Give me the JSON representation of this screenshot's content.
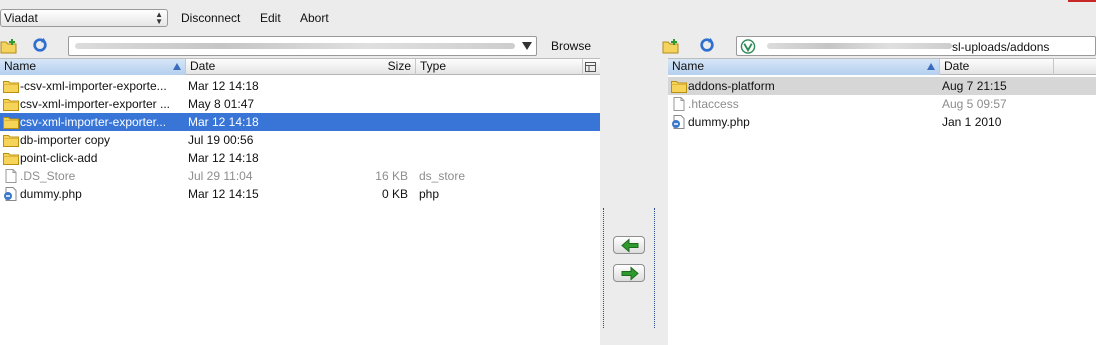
{
  "toolbar": {
    "server_select": "Viadat",
    "disconnect": "Disconnect",
    "edit": "Edit",
    "abort": "Abort"
  },
  "local": {
    "browse": "Browse",
    "columns": {
      "name": "Name",
      "date": "Date",
      "size": "Size",
      "type": "Type"
    },
    "rows": [
      {
        "name": "-csv-xml-importer-exporte...",
        "date": "Mar 12 14:18",
        "size": "",
        "type": "",
        "kind": "folder"
      },
      {
        "name": "csv-xml-importer-exporter ...",
        "date": "May 8 01:47",
        "size": "",
        "type": "",
        "kind": "folder"
      },
      {
        "name": "csv-xml-importer-exporter...",
        "date": "Mar 12 14:18",
        "size": "",
        "type": "",
        "kind": "folder",
        "selected": true
      },
      {
        "name": "db-importer copy",
        "date": "Jul 19 00:56",
        "size": "",
        "type": "",
        "kind": "folder"
      },
      {
        "name": "point-click-add",
        "date": "Mar 12 14:18",
        "size": "",
        "type": "",
        "kind": "folder"
      },
      {
        "name": ".DS_Store",
        "date": "Jul 29 11:04",
        "size": "16 KB",
        "type": "ds_store",
        "kind": "file",
        "dim": true
      },
      {
        "name": "dummy.php",
        "date": "Mar 12 14:15",
        "size": "0 KB",
        "type": "php",
        "kind": "php"
      }
    ]
  },
  "remote": {
    "path_tail": "sl-uploads/addons",
    "columns": {
      "name": "Name",
      "date": "Date"
    },
    "rows": [
      {
        "name": "addons-platform",
        "date": "Aug 7 21:15",
        "kind": "folder",
        "highlight": true
      },
      {
        "name": ".htaccess",
        "date": "Aug 5 09:57",
        "kind": "file",
        "dim": true
      },
      {
        "name": "dummy.php",
        "date": "Jan 1 2010",
        "kind": "php"
      }
    ]
  },
  "transfer": {
    "upload_icon": "arrow-left-icon",
    "download_icon": "arrow-right-icon",
    "accent": "#2e9a2e"
  },
  "colors": {
    "selection": "#3875d7",
    "sorted_header": "#b5cfee"
  }
}
